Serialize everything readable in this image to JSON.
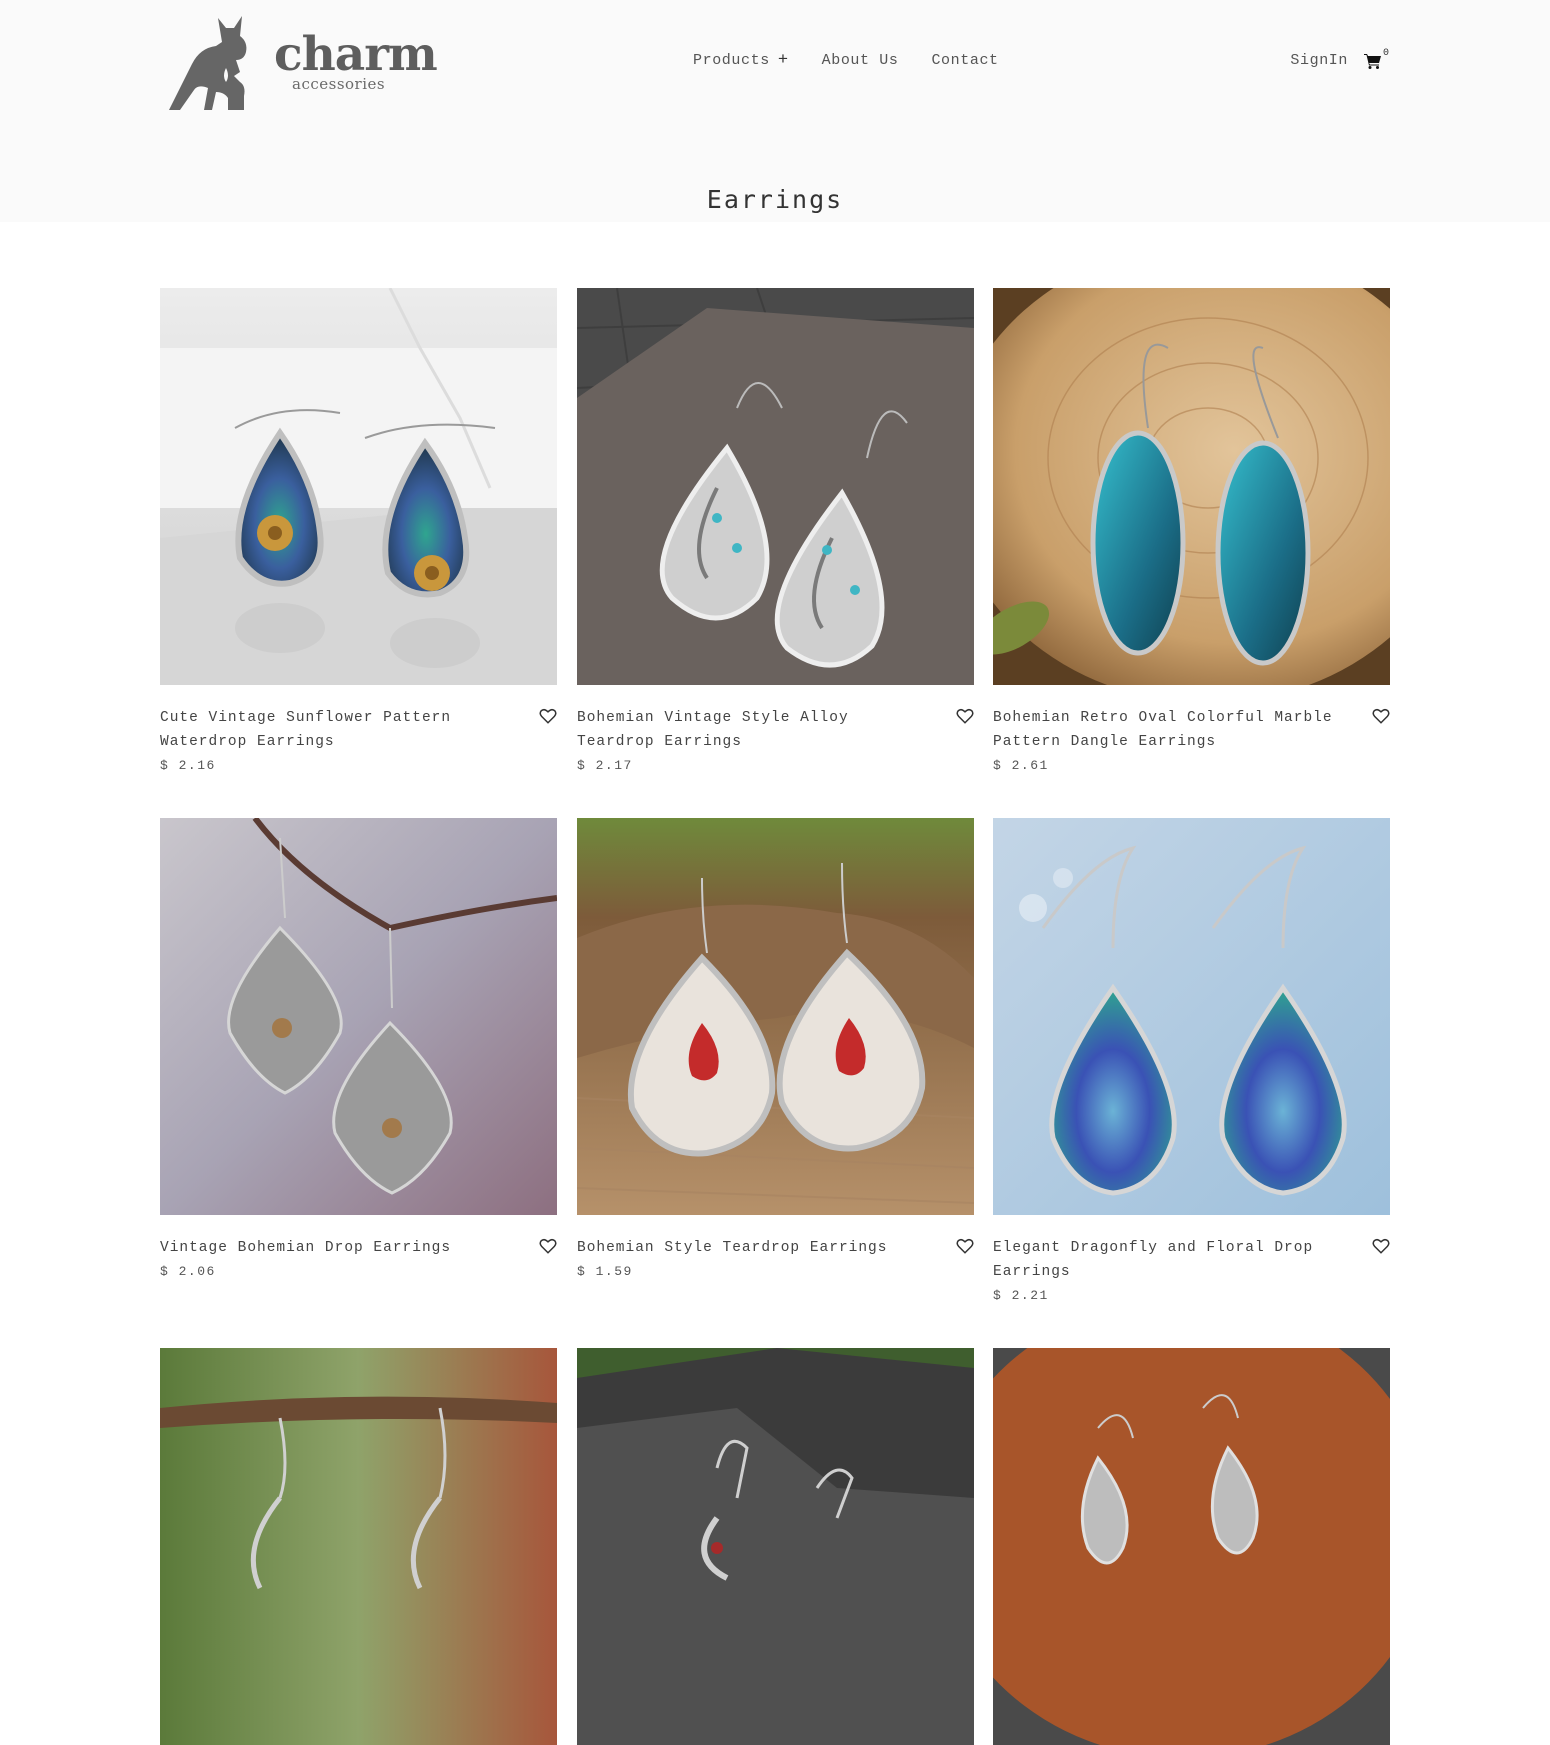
{
  "brand": {
    "name": "charm",
    "tagline": "accessories",
    "logo_icon": "kangaroo-logo-icon"
  },
  "nav": {
    "products": "Products",
    "about": "About Us",
    "contact": "Contact",
    "products_expand_icon": "plus-icon"
  },
  "account": {
    "signin": "SignIn",
    "cart_icon": "shopping-cart-icon",
    "cart_count": "0"
  },
  "page": {
    "title": "Earrings"
  },
  "products": [
    {
      "name": "Cute Vintage Sunflower Pattern Waterdrop Earrings",
      "price": "$ 2.16",
      "wishlist_icon": "heart-outline-icon"
    },
    {
      "name": "Bohemian Vintage Style Alloy Teardrop Earrings",
      "price": "$ 2.17",
      "wishlist_icon": "heart-outline-icon"
    },
    {
      "name": "Bohemian Retro Oval Colorful Marble Pattern Dangle Earrings",
      "price": "$ 2.61",
      "wishlist_icon": "heart-outline-icon"
    },
    {
      "name": "Vintage Bohemian Drop Earrings",
      "price": "$ 2.06",
      "wishlist_icon": "heart-outline-icon"
    },
    {
      "name": "Bohemian Style Teardrop Earrings",
      "price": "$ 1.59",
      "wishlist_icon": "heart-outline-icon"
    },
    {
      "name": "Elegant Dragonfly and Floral Drop Earrings",
      "price": "$ 2.21",
      "wishlist_icon": "heart-outline-icon"
    },
    {
      "name": "",
      "price": "",
      "wishlist_icon": "heart-outline-icon"
    },
    {
      "name": "",
      "price": "",
      "wishlist_icon": "heart-outline-icon"
    },
    {
      "name": "",
      "price": "",
      "wishlist_icon": "heart-outline-icon"
    }
  ]
}
